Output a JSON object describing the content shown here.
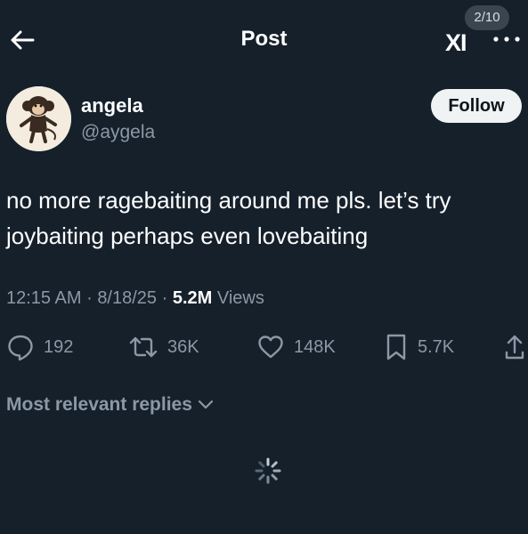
{
  "header": {
    "title": "Post",
    "image_counter": "2/10",
    "brand_mark": "XI",
    "back_icon": "arrow-left-icon",
    "more_icon": "more-horizontal-icon"
  },
  "author": {
    "name": "angela",
    "handle": "@aygela",
    "follow_label": "Follow"
  },
  "post": {
    "text_line1": "no more ragebaiting around me pls. let’s try",
    "text_line2": "joybaiting perhaps even lovebaiting",
    "time": "12:15 AM",
    "date": "8/18/25",
    "views_count": "5.2M",
    "views_label": "Views",
    "separator": "·"
  },
  "actions": {
    "replies": "192",
    "reposts": "36K",
    "likes": "148K",
    "bookmarks": "5.7K"
  },
  "replies_section": {
    "sort_label": "Most relevant replies"
  },
  "colors": {
    "background": "#15202b",
    "secondary_text": "#8b98a5",
    "follow_bg": "#eff3f4"
  }
}
